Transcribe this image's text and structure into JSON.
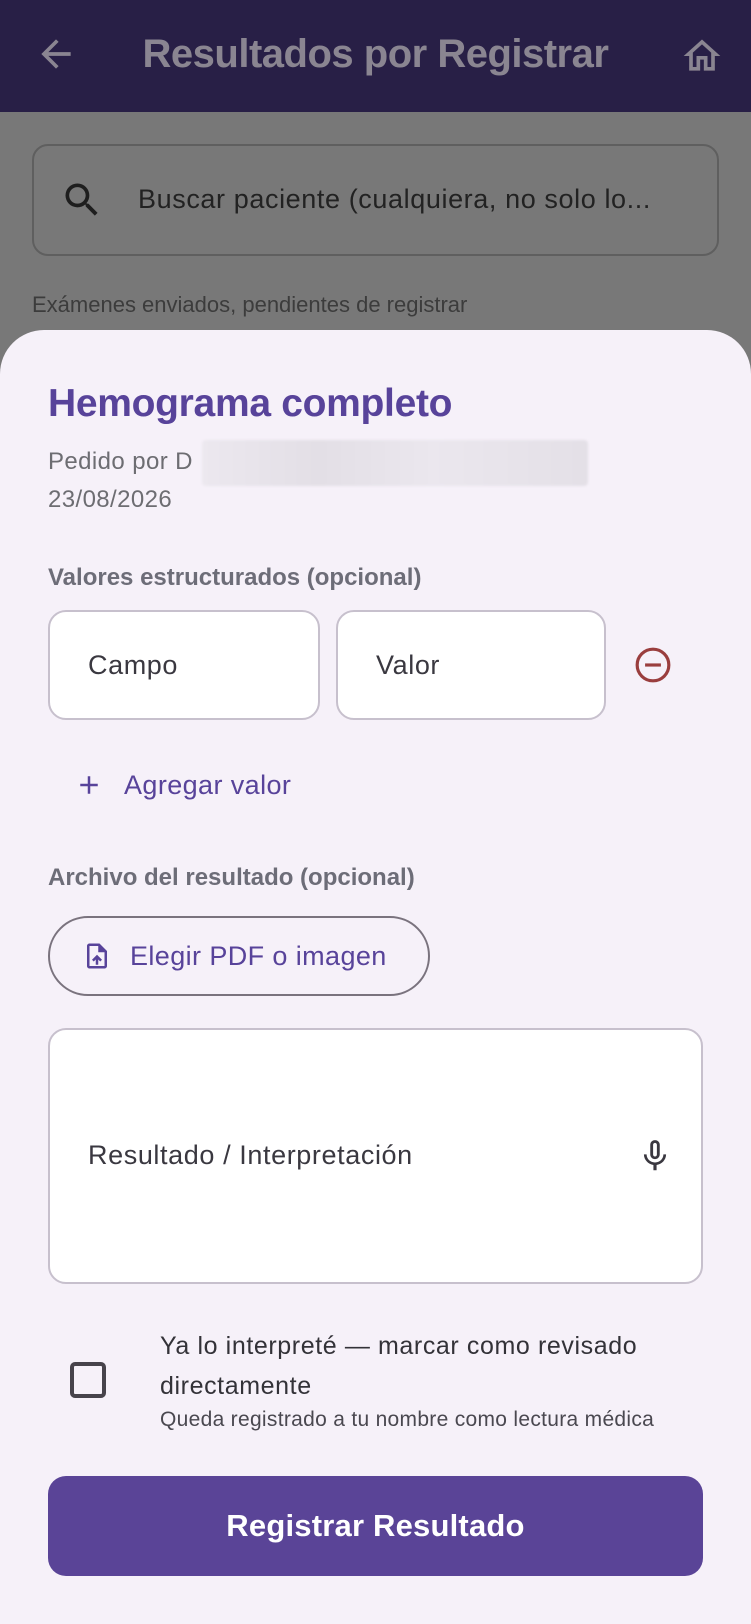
{
  "appbar": {
    "title": "Resultados por Registrar",
    "back_icon": "arrow-left-icon",
    "home_icon": "home-icon"
  },
  "search": {
    "placeholder": "Buscar paciente (cualquiera, no solo lo...",
    "icon": "search-icon"
  },
  "list": {
    "section_note": "Exámenes enviados, pendientes de registrar"
  },
  "sheet": {
    "exam_title": "Hemograma completo",
    "ordered_by": "Pedido por D",
    "date": "23/08/2026",
    "values_section": {
      "label": "Valores estructurados (opcional)",
      "field_placeholder": "Campo",
      "value_placeholder": "Valor",
      "remove_icon": "minus-circle-icon",
      "add_label": "Agregar valor"
    },
    "file_section": {
      "label": "Archivo del resultado (opcional)",
      "button_label": "Elegir PDF o imagen",
      "icon": "file-upload-icon"
    },
    "result_field": {
      "placeholder": "Resultado / Interpretación",
      "mic_icon": "microphone-icon"
    },
    "reviewed": {
      "checked": false,
      "label": "Ya lo interpreté — marcar como revisado directamente",
      "sublabel": "Queda registrado a tu nombre como lectura médica"
    },
    "submit_label": "Registrar Resultado"
  },
  "colors": {
    "appbar": "#281f46",
    "accent": "#58439a",
    "button": "#5a4497",
    "sheet_bg": "#f6f1f9",
    "remove_icon": "#9a3e3e"
  }
}
